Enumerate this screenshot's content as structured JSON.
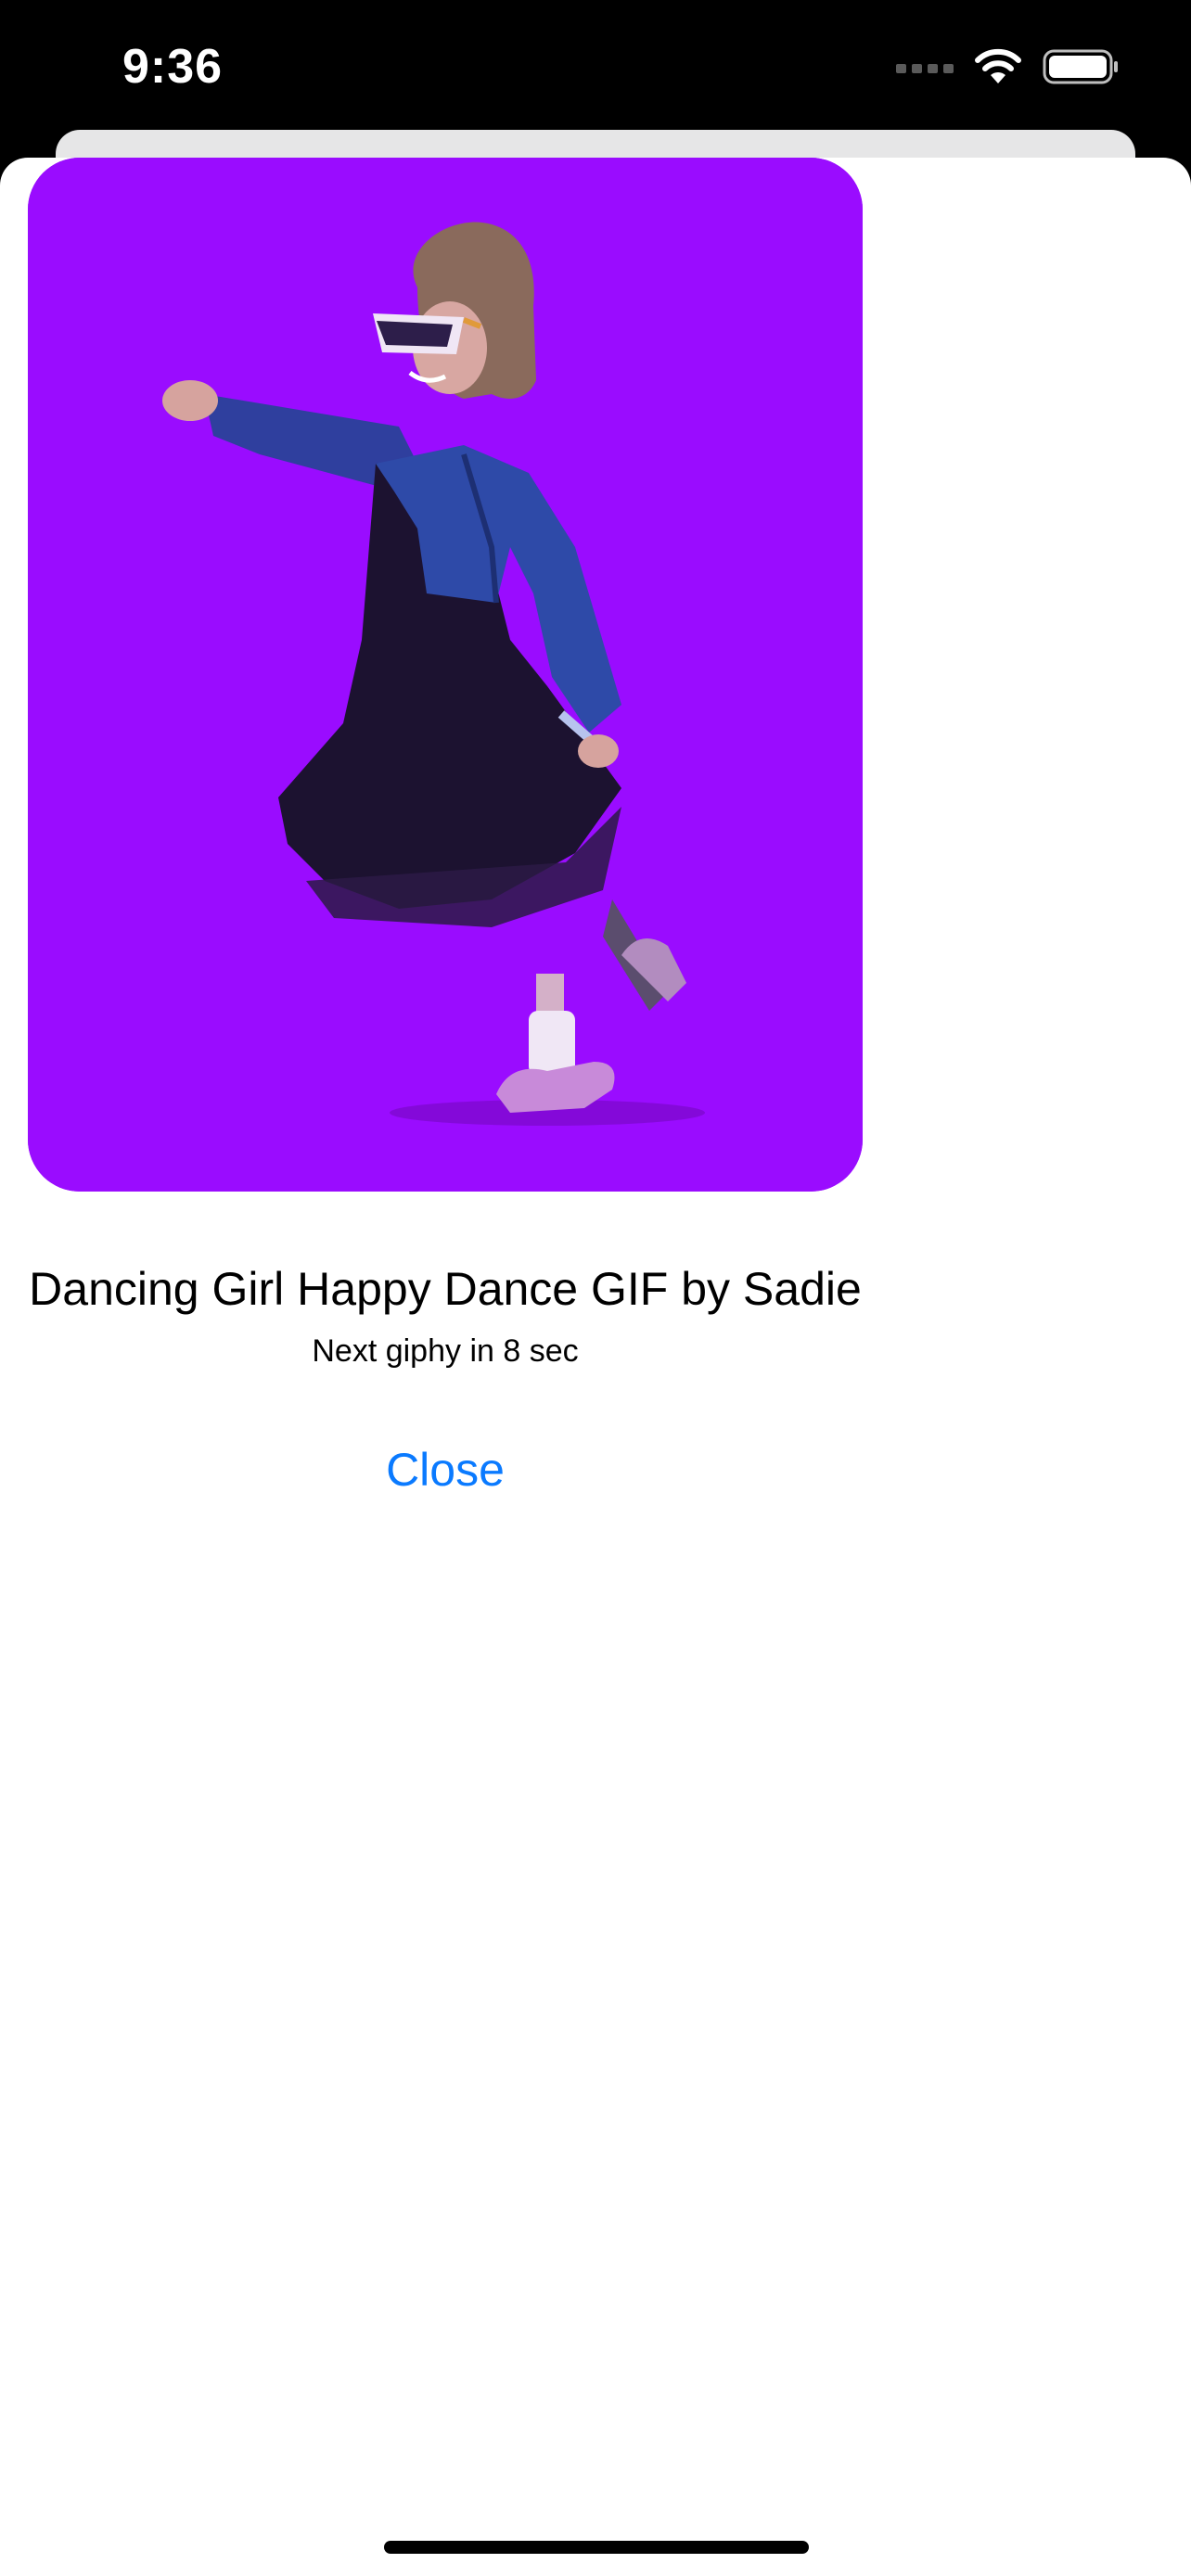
{
  "status_bar": {
    "time": "9:36",
    "icons": [
      "cellular-signal-icon",
      "wifi-icon",
      "battery-icon"
    ]
  },
  "gif": {
    "title": "Dancing Girl Happy Dance GIF by Sadie",
    "countdown": "Next giphy in 8 sec",
    "background_color": "#9a0cff"
  },
  "actions": {
    "close_label": "Close"
  },
  "colors": {
    "accent": "#0a7aff",
    "status_bar_bg": "#000000",
    "sheet_bg": "#ffffff"
  }
}
